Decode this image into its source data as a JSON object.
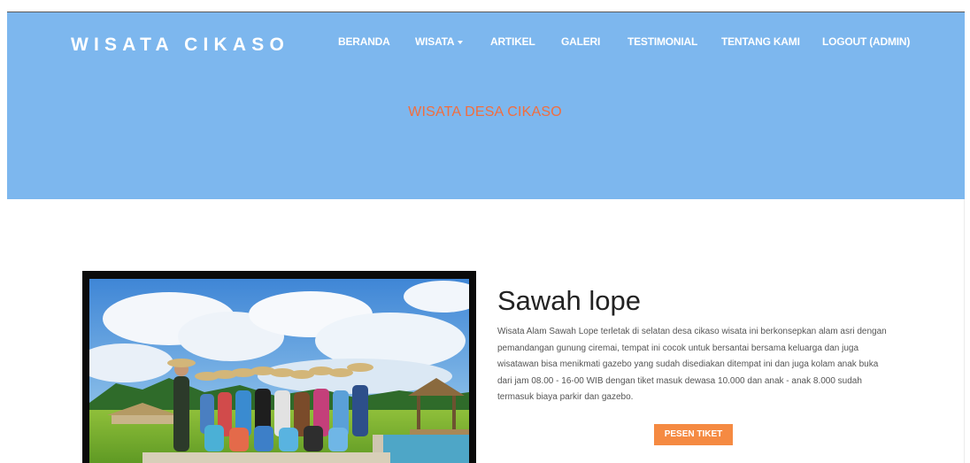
{
  "brand": {
    "name": "WISATA CIKASO"
  },
  "nav": {
    "items": [
      {
        "label": "BERANDA"
      },
      {
        "label": "WISATA",
        "has_dropdown": true
      },
      {
        "label": "ARTIKEL"
      },
      {
        "label": "GALERI"
      },
      {
        "label": "TESTIMONIAL"
      },
      {
        "label": "TENTANG KAMI"
      },
      {
        "label": "LOGOUT (ADMIN)"
      }
    ]
  },
  "hero": {
    "title": "WISATA DESA CIKASO"
  },
  "post": {
    "title": "Sawah lope",
    "description": "Wisata Alam Sawah Lope terletak di selatan desa cikaso wisata ini berkonsepkan alam asri dengan pemandangan gunung ciremai, tempat ini cocok untuk bersantai bersama keluarga dan juga wisatawan bisa menikmati gazebo yang sudah disediakan ditempat ini dan juga kolam anak buka dari jam 08.00 - 16-00 WIB dengan tiket masuk dewasa 10.000 dan anak - anak 8.000 sudah termasuk biaya parkir dan gazebo.",
    "button_label": "PESEN TIKET"
  },
  "colors": {
    "hero_bg": "#7db7ee",
    "hero_title": "#f26d3d",
    "button_bg": "#f58a42"
  }
}
